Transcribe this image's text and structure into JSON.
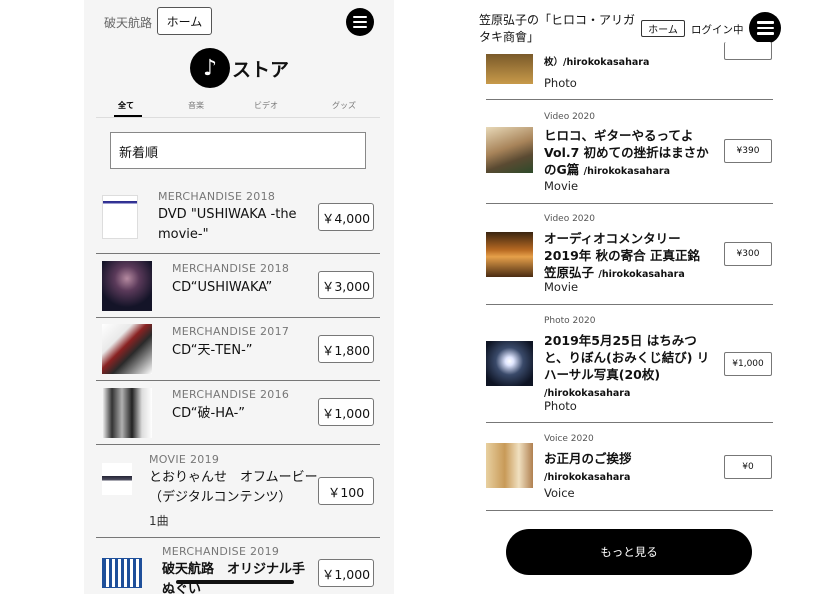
{
  "left": {
    "brand": "破天航路",
    "home_label": "ホーム",
    "store_icon": "music-note-icon",
    "store_title": "ストア",
    "tabs": [
      "全て",
      "音楽",
      "ビデオ",
      "グッズ"
    ],
    "sort_value": "新着順",
    "items": [
      {
        "category": "MERCHANDISE 2018",
        "title": "DVD \"USHIWAKA -the movie-\"",
        "price": "￥4,000"
      },
      {
        "category": "MERCHANDISE 2018",
        "title": "CD“USHIWAKA”",
        "price": "￥3,000"
      },
      {
        "category": "MERCHANDISE 2017",
        "title": "CD“天-TEN-”",
        "price": "￥1,800"
      },
      {
        "category": "MERCHANDISE 2016",
        "title": "CD“破-HA-”",
        "price": "￥1,000"
      },
      {
        "category": "MOVIE 2019",
        "title": "とおりゃんせ　オフムービー（デジタルコンテンツ）",
        "sub": "1曲",
        "price": "￥100"
      },
      {
        "category": "MERCHANDISE 2019",
        "title": "破天航路　オリジナル手ぬぐい",
        "price": "￥1,000"
      }
    ]
  },
  "right": {
    "brand": "笠原弘子の「ヒロコ・アリガタキ商會」",
    "home_label": "ホーム",
    "login_label": "ログイン中",
    "top_partial": {
      "title_tail": "枚）/hirokokasahara",
      "kind": "Photo"
    },
    "items": [
      {
        "category": "Video 2020",
        "title": "ヒロコ、ギターやるってよ Vol.7 初めての挫折はまさかのG篇",
        "user": "/hirokokasahara",
        "kind": "Movie",
        "price": "¥390"
      },
      {
        "category": "Video 2020",
        "title": "オーディオコメンタリー 2019年 秋の寄合 正真正銘 笠原弘子",
        "user": "/hirokokasahara",
        "kind": "Movie",
        "price": "¥300"
      },
      {
        "category": "Photo 2020",
        "title": "2019年5月25日 はちみつと、りぼん(おみくじ結び) リハーサル写真(20枚)",
        "user": "/hirokokasahara",
        "kind": "Photo",
        "price": "¥1,000"
      },
      {
        "category": "Voice 2020",
        "title": "お正月のご挨拶",
        "user": "/hirokokasahara",
        "kind": "Voice",
        "price": "¥0"
      }
    ],
    "more_label": "もっと見る"
  }
}
